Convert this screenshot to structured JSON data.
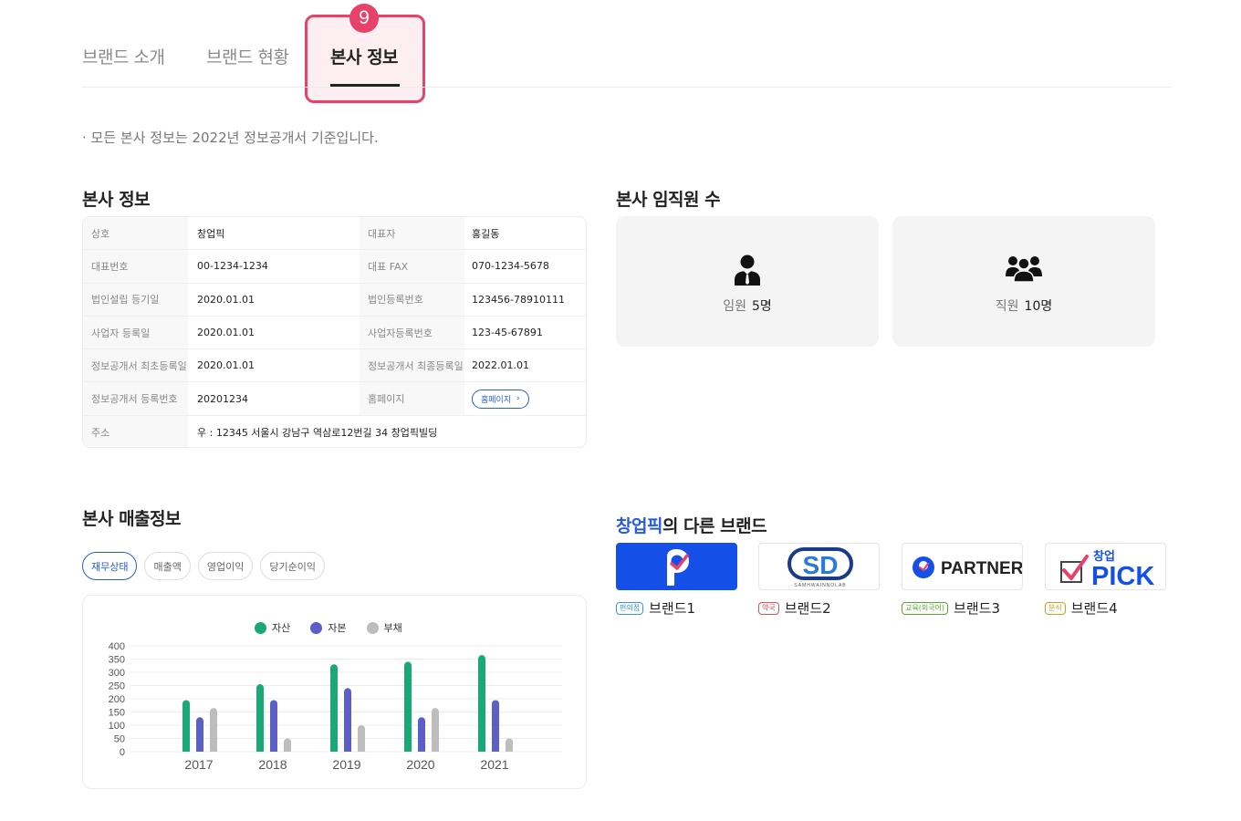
{
  "tabs": [
    {
      "label": "브랜드 소개",
      "active": false
    },
    {
      "label": "브랜드 현황",
      "active": false
    },
    {
      "label": "본사 정보",
      "active": true
    }
  ],
  "step_badge": "9",
  "notice": "· 모든 본사 정보는 2022년 정보공개서 기준입니다.",
  "hq_info": {
    "title": "본사 정보",
    "rows": [
      {
        "label1": "상호",
        "value1": "창업픽",
        "label2": "대표자",
        "value2": "홍길동"
      },
      {
        "label1": "대표번호",
        "value1": "00-1234-1234",
        "label2": "대표 FAX",
        "value2": "070-1234-5678"
      },
      {
        "label1": "법인설립 등기일",
        "value1": "2020.01.01",
        "label2": "법인등록번호",
        "value2": "123456-78910111"
      },
      {
        "label1": "사업자 등록일",
        "value1": "2020.01.01",
        "label2": "사업자등록번호",
        "value2": "123-45-67891"
      },
      {
        "label1": "정보공개서 최초등록일",
        "value1": "2020.01.01",
        "label2": "정보공개서 최종등록일",
        "value2": "2022.01.01"
      },
      {
        "label1": "정보공개서 등록번호",
        "value1": "20201234",
        "label2": "홈페이지",
        "value2": ""
      }
    ],
    "homepage_button": "홈페이지",
    "address_label": "주소",
    "address_value": "우 : 12345 서울시 강남구 역삼로12번길 34 창업픽빌딩"
  },
  "employees": {
    "title": "본사 임직원 수",
    "executives_label": "임원",
    "executives_value": "5명",
    "staff_label": "직원",
    "staff_value": "10명"
  },
  "sales": {
    "title": "본사 매출정보",
    "filters": [
      "재무상태",
      "매출액",
      "영업이익",
      "당기순이익"
    ],
    "active_filter": "재무상태"
  },
  "chart_data": {
    "type": "bar",
    "categories": [
      "2017",
      "2018",
      "2019",
      "2020",
      "2021"
    ],
    "series": [
      {
        "name": "자산",
        "color": "#1aa876",
        "values": [
          195,
          255,
          330,
          340,
          365
        ]
      },
      {
        "name": "자본",
        "color": "#5b5fc7",
        "values": [
          130,
          195,
          240,
          130,
          195
        ]
      },
      {
        "name": "부채",
        "color": "#bdbdbd",
        "values": [
          165,
          50,
          100,
          165,
          50
        ]
      }
    ],
    "ylim": [
      0,
      400
    ],
    "yticks": [
      "0",
      "50",
      "100",
      "150",
      "200",
      "250",
      "300",
      "350",
      "400"
    ],
    "grid": true,
    "legend_position": "top-center"
  },
  "brands": {
    "title_highlight": "창업픽",
    "title_rest": "의 다른 브랜드",
    "items": [
      {
        "name": "브랜드1",
        "tag": "편의점",
        "tag_color": "#3a9ad9"
      },
      {
        "name": "브랜드2",
        "tag": "약국",
        "tag_color": "#e05050"
      },
      {
        "name": "브랜드3",
        "tag": "교육(외국어)",
        "tag_color": "#5aa832"
      },
      {
        "name": "브랜드4",
        "tag": "분식",
        "tag_color": "#c9a020"
      }
    ],
    "logo2_text": "SD",
    "logo2_subtext": "SAMHWAINNOLAB",
    "logo3_text": "PARTNER",
    "logo4_top": "창업",
    "logo4_text": "PICK"
  }
}
